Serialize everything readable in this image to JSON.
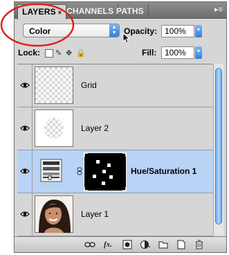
{
  "tabs": [
    {
      "label": "LAYERS",
      "active": true
    },
    {
      "label": "CHANNELS",
      "active": false
    },
    {
      "label": "PATHS",
      "active": false
    }
  ],
  "tab_close_glyph": "×",
  "panel_menu_glyph": "▸≡",
  "blend_mode": {
    "value": "Color"
  },
  "opacity": {
    "label": "Opacity:",
    "value": "100%"
  },
  "lock": {
    "label": "Lock:"
  },
  "fill": {
    "label": "Fill:",
    "value": "100%"
  },
  "layers": [
    {
      "name": "Grid",
      "bold": false,
      "selected": false,
      "visible": true
    },
    {
      "name": "Layer 2",
      "bold": false,
      "selected": false,
      "visible": true
    },
    {
      "name": "Hue/Saturation 1",
      "bold": true,
      "selected": true,
      "visible": true
    },
    {
      "name": "Layer 1",
      "bold": false,
      "selected": false,
      "visible": true
    }
  ],
  "bottom_icons": [
    "link-layers-icon",
    "fx-icon",
    "add-mask-icon",
    "adjustment-layer-icon",
    "new-group-icon",
    "new-layer-icon",
    "trash-icon"
  ],
  "colors": {
    "selection": "#b8d3f5",
    "annotation": "#e0201c",
    "accent": "#2f7fe0"
  }
}
